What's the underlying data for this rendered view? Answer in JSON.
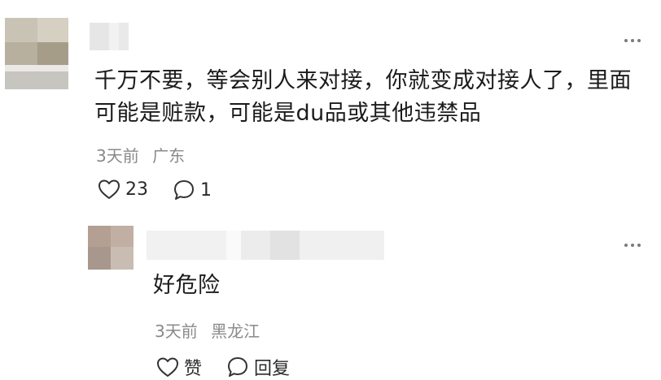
{
  "comment": {
    "text_line1": "千万不要，等会别人来对接，你就变成对接人了，里面",
    "text_line2": "可能是赃款，可能是du品或其他违禁品",
    "time": "3天前",
    "location": "广东",
    "like_count": "23",
    "reply_count": "1",
    "icons": {
      "like": "heart-outline-icon",
      "reply": "speech-bubble-outline-icon",
      "more": "ellipsis-icon"
    }
  },
  "reply": {
    "text": "好危险",
    "time": "3天前",
    "location": "黑龙江",
    "like_label": "赞",
    "reply_label": "回复",
    "icons": {
      "like": "heart-outline-icon",
      "reply": "speech-bubble-outline-icon",
      "more": "ellipsis-icon"
    }
  },
  "colors": {
    "text": "#1b1b1b",
    "meta": "#8a8a8a",
    "icon": "#333333"
  }
}
